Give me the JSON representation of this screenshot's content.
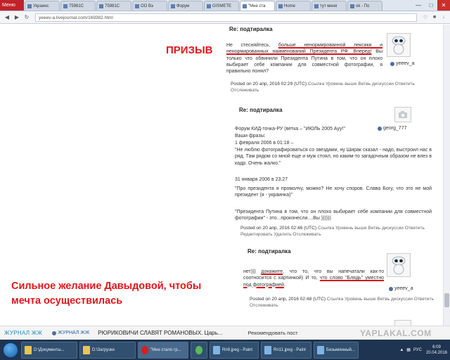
{
  "browser": {
    "menu_label": "Меню",
    "tabs": [
      {
        "label": "Украинс"
      },
      {
        "label": "75981С"
      },
      {
        "label": "75981С"
      },
      {
        "label": "ОО Вэ"
      },
      {
        "label": "Форум"
      },
      {
        "label": "GISMETE"
      },
      {
        "label": "\"Мне ста",
        "active": true
      },
      {
        "label": "Home"
      },
      {
        "label": "тут меня"
      },
      {
        "label": "ok - По"
      }
    ],
    "url": "yeeev-a.livejournal.com/169382.html"
  },
  "comments": {
    "c1": {
      "header": "Re: подтиралка",
      "text_pre": "Не стесняйтесь, ",
      "text_ul1": "больше ненормированной лексики и ненормированных наименований Президента РФ. Вперед!",
      "text_post": " Вы только что обвинили Президента Путина в том, что он плохо выбирает себе компании для совместной фотографии, я правильно понял?",
      "username": "yeeev_a",
      "date": "Posted on 20 апр, 2016 02:29 (UTC)",
      "links": "Ссылка Уровень выше Ветвь дискуссии Ответить Отслеживать"
    },
    "c2": {
      "header": "Re: подтиралка",
      "username": "georg_777",
      "text_lines": [
        "Форум КИД-точка-РУ (ветка – \"ИЮЛЬ 2005 Ауу!\"",
        "Ваши фразы:",
        "1 февраля 2006 в 01:18 –",
        "\"Не люблю фотографироваться со звездами, ну Ширак сказал - надо, выстроил нас в ряд. Там рядом со мной еще и муж стоял, но каким-то загадочным образом не влез в кадр. Очень жалко.\"",
        "31 января 2006 в 23:27",
        "\"Про президента я промолчу, можно? Не хочу споров. Слава Богу, что это не мой президент (я - украинка)\"",
        "\"Президента Путина в том, что он плохо выбирает себе компании для совместной фотографии\" - это...произнесли....Вы ))))))"
      ],
      "date": "Posted on 20 апр, 2016 02:46 (UTC)",
      "links": "Ссылка Уровень выше Ветвь дискуссии Ответить Редактировать Удалить Отслеживать"
    },
    "c3": {
      "header": "Re: подтиралка",
      "text_pre": "нет))) ",
      "text_ul1": "докажите",
      "text_mid": ", что то, что вы напечатали как-то соотносится с картинкой) И то, ",
      "text_ul2": "что слово \"Блядь\" уместно под фотографией",
      "text_post": ".",
      "username": "yeeev_a",
      "date": "Posted on 20 апр, 2016 02:48 (UTC)",
      "links": "Ссылка Уровень выше Ветвь дискуссии Ответить Отслеживать"
    }
  },
  "overlays": {
    "note1": "ПРИЗЫВ",
    "note2_line1": "Сильное желание Давыдовой, чтобы",
    "note2_line2": "мечта осуществилась"
  },
  "ticker": {
    "logo": "ЖУРНАЛ ЖЖ",
    "user": "ЖУРНАЛ ЖЖ",
    "news": "РЮРИКОВИЧИ СЛАВЯТ РОМАНОВЫХ. Царь...",
    "rec": "Рекомендовать пост",
    "watermark": "YAPLAKAL.COM"
  },
  "taskbar": {
    "items": [
      {
        "label": "D:\\Документы..."
      },
      {
        "label": "D:\\Загрузки"
      },
      {
        "label": "\"Мне стало гр..."
      },
      {
        "label": "Rn9.jpeg - Paint"
      },
      {
        "label": "Rn11.jpeg - Paint"
      },
      {
        "label": "Безымянный..."
      }
    ],
    "lang": "РУС",
    "time": "6:09",
    "date": "20.04.2016"
  }
}
